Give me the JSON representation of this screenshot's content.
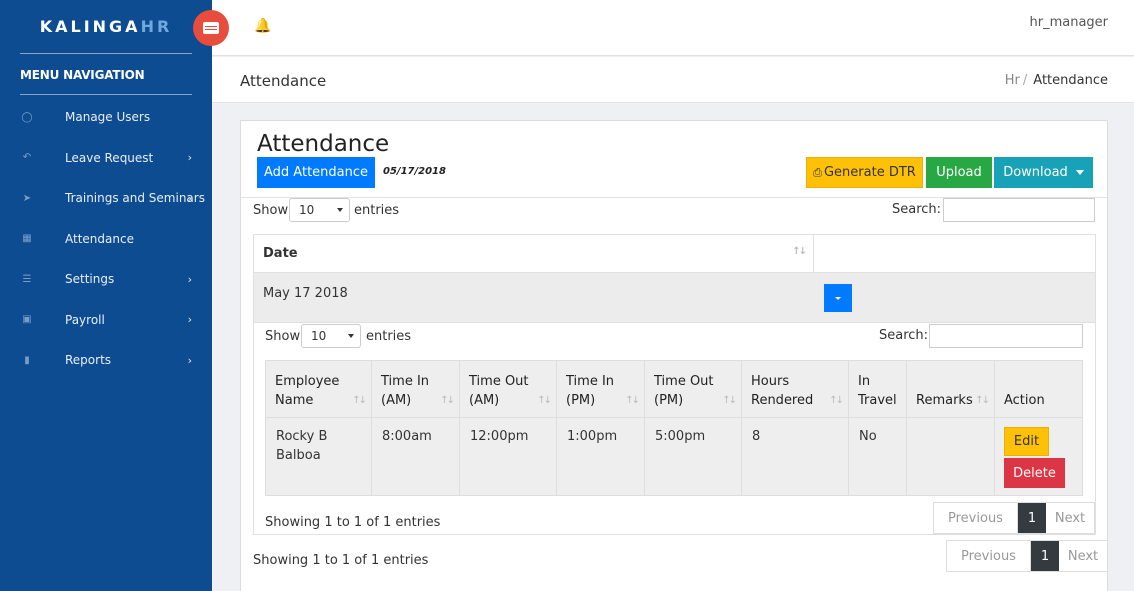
{
  "brand": {
    "name_a": "KALINGA",
    "name_b": "HR"
  },
  "sidebar": {
    "heading": "MENU NAVIGATION",
    "items": [
      {
        "label": "Manage Users",
        "icon": "user-icon",
        "glyph": "&#9711;",
        "chevron": false
      },
      {
        "label": "Leave Request",
        "icon": "reply-icon",
        "glyph": "&#8630;",
        "chevron": true
      },
      {
        "label": "Trainings and Seminars",
        "icon": "megaphone-icon",
        "glyph": "&#10148;",
        "chevron": true
      },
      {
        "label": "Attendance",
        "icon": "calendar-icon",
        "glyph": "&#9638;",
        "chevron": false
      },
      {
        "label": "Settings",
        "icon": "list-icon",
        "glyph": "&#9776;",
        "chevron": true
      },
      {
        "label": "Payroll",
        "icon": "money-icon",
        "glyph": "&#9635;",
        "chevron": true
      },
      {
        "label": "Reports",
        "icon": "file-icon",
        "glyph": "&#9646;",
        "chevron": true
      }
    ],
    "chevron_glyph": "›"
  },
  "topbar": {
    "user": "hr_manager",
    "bell": "&#128276;"
  },
  "page": {
    "title": "Attendance",
    "breadcrumb": {
      "parent": "Hr",
      "sep": "/",
      "current": "Attendance"
    }
  },
  "card": {
    "title": "Attendance",
    "add_button": "Add Attendance",
    "date": "05/17/2018",
    "generate_dtr": "Generate DTR",
    "upload": "Upload",
    "download": "Download",
    "show": "Show",
    "entries": "entries",
    "search": "Search:",
    "page_length": "10"
  },
  "outer_table": {
    "columns": [
      "Date",
      ""
    ],
    "rows": [
      {
        "date": "May 17 2018"
      }
    ],
    "info": "Showing 1 to 1 of 1 entries",
    "pager": {
      "prev": "Previous",
      "page": "1",
      "next": "Next"
    }
  },
  "inner_table": {
    "show": "Show",
    "entries": "entries",
    "search": "Search:",
    "page_length": "10",
    "columns": [
      {
        "l1": "Employee",
        "l2": "Name"
      },
      {
        "l1": "Time In",
        "l2": "(AM)"
      },
      {
        "l1": "Time Out",
        "l2": "(AM)"
      },
      {
        "l1": "Time In",
        "l2": "(PM)"
      },
      {
        "l1": "Time Out",
        "l2": "(PM)"
      },
      {
        "l1": "Hours",
        "l2": "Rendered"
      },
      {
        "l1": "In",
        "l2": "Travel"
      },
      {
        "l1": "",
        "l2": "Remarks"
      },
      {
        "l1": "",
        "l2": "Action"
      }
    ],
    "rows": [
      {
        "employee_l1": "Rocky B",
        "employee_l2": "Balboa",
        "time_in_am": "8:00am",
        "time_out_am": "12:00pm",
        "time_in_pm": "1:00pm",
        "time_out_pm": "5:00pm",
        "hours": "8",
        "in_travel": "No",
        "remarks": "",
        "edit": "Edit",
        "delete": "Delete"
      }
    ],
    "info": "Showing 1 to 1 of 1 entries",
    "pager": {
      "prev": "Previous",
      "page": "1",
      "next": "Next"
    }
  },
  "colors": {
    "sidebar": "#0e4c92",
    "primary": "#007bff",
    "warning": "#ffc107",
    "success": "#28a745",
    "info": "#17a2b8",
    "danger": "#dc3545",
    "toggle": "#e74c3c"
  }
}
